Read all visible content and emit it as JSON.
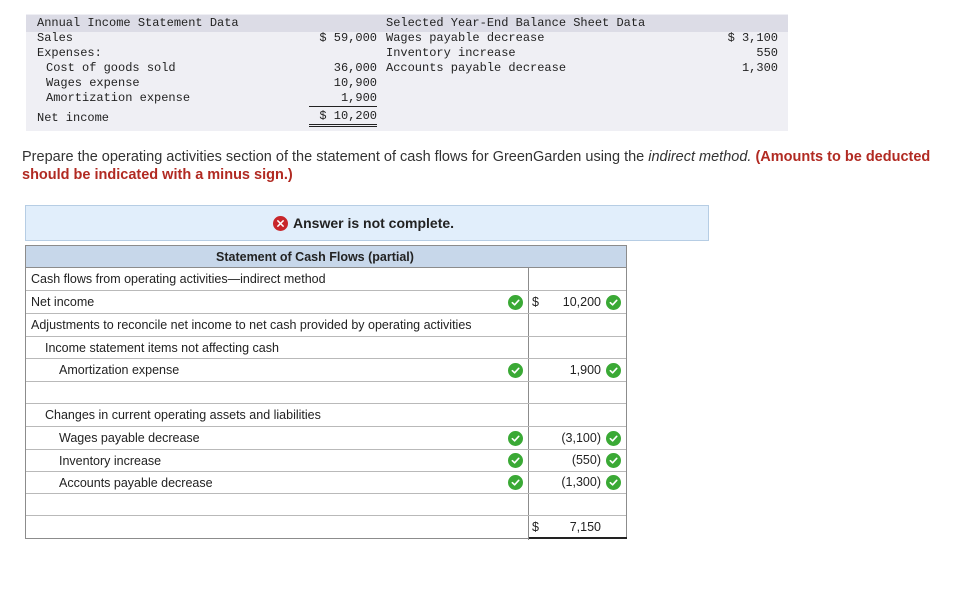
{
  "income_statement": {
    "header": "Annual Income Statement Data",
    "sales_label": "Sales",
    "sales_value": "$ 59,000",
    "expenses_label": "Expenses:",
    "cogs_label": "Cost of goods sold",
    "cogs_value": "36,000",
    "wages_label": "Wages expense",
    "wages_value": "10,900",
    "amort_label": "Amortization expense",
    "amort_value": "1,900",
    "net_label": "Net income",
    "net_value": "$ 10,200"
  },
  "balance_sheet": {
    "header": "Selected Year-End Balance Sheet Data",
    "wp_label": "Wages payable decrease",
    "wp_value": "$ 3,100",
    "inv_label": "Inventory increase",
    "inv_value": "550",
    "ap_label": "Accounts payable decrease",
    "ap_value": "1,300"
  },
  "instructions": {
    "part1": "Prepare the operating activities section of the statement of cash flows for GreenGarden using the ",
    "method": "indirect method.",
    "note": " (Amounts to be deducted should be indicated with a minus sign.)"
  },
  "status": {
    "text": "Answer is not complete."
  },
  "statement": {
    "title": "Statement of Cash Flows (partial)",
    "rows": {
      "section": "Cash flows from operating activities—indirect method",
      "net_income": "Net income",
      "adjustments": "Adjustments to reconcile net income to net cash provided by operating activities",
      "not_affecting": "Income statement items not affecting cash",
      "amortization": "Amortization expense",
      "changes": "Changes in current operating assets and liabilities",
      "wages_payable": "Wages payable decrease",
      "inventory": "Inventory increase",
      "accounts_payable": "Accounts payable decrease"
    },
    "values": {
      "currency": "$",
      "net_income": "10,200",
      "amortization": "1,900",
      "wages_payable": "(3,100)",
      "inventory": "(550)",
      "accounts_payable": "(1,300)",
      "total": "7,150"
    }
  },
  "colors": {
    "correct": "#3aa935",
    "incorrect": "#c8262b",
    "banner": "#e1eefb",
    "table_header": "#c7d7ea",
    "note_red": "#b12a22"
  },
  "icons": [
    "check-icon",
    "x-circle-icon"
  ]
}
